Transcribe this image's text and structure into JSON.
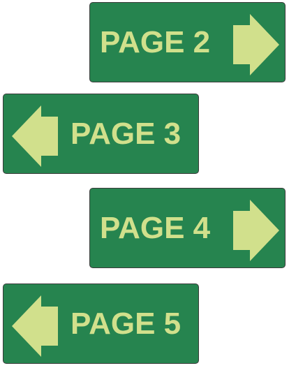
{
  "colors": {
    "button": "#26844f",
    "text": "#d1e08c"
  },
  "buttons": [
    {
      "label": "PAGE 2",
      "icon": "arrow-right-icon"
    },
    {
      "label": "PAGE 3",
      "icon": "arrow-left-icon"
    },
    {
      "label": "PAGE 4",
      "icon": "arrow-right-icon"
    },
    {
      "label": "PAGE 5",
      "icon": "arrow-left-icon"
    }
  ]
}
